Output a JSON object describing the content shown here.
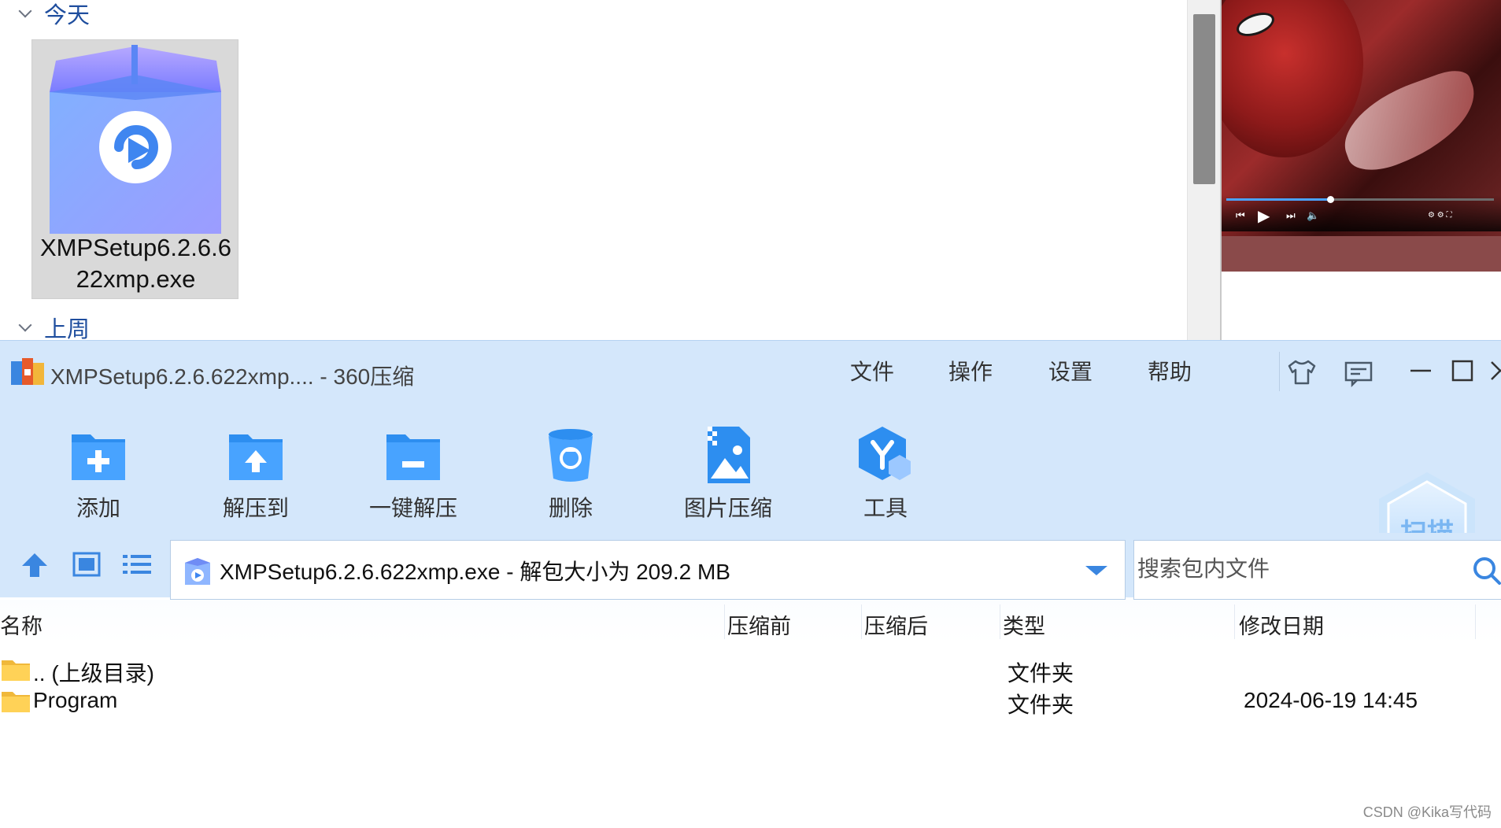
{
  "explorer": {
    "groups": [
      {
        "label": "今天"
      },
      {
        "label": "上周"
      }
    ],
    "file": {
      "name": "XMPSetup6.2.6.622xmp.exe"
    }
  },
  "app": {
    "title": "XMPSetup6.2.6.622xmp.... - 360压缩",
    "menu": [
      "文件",
      "操作",
      "设置",
      "帮助"
    ],
    "toolbar": [
      {
        "label": "添加",
        "icon": "add-folder-icon"
      },
      {
        "label": "解压到",
        "icon": "extract-to-icon"
      },
      {
        "label": "一键解压",
        "icon": "one-click-extract-icon"
      },
      {
        "label": "删除",
        "icon": "trash-icon"
      },
      {
        "label": "图片压缩",
        "icon": "image-compress-icon"
      },
      {
        "label": "工具",
        "icon": "tools-icon"
      }
    ],
    "scan_label": "扫描",
    "address": "XMPSetup6.2.6.622xmp.exe - 解包大小为 209.2 MB",
    "search_placeholder": "搜索包内文件",
    "columns": [
      "名称",
      "压缩前",
      "压缩后",
      "类型",
      "修改日期"
    ],
    "rows": [
      {
        "name": ".. (上级目录)",
        "type": "文件夹",
        "date": ""
      },
      {
        "name": "Program",
        "type": "文件夹",
        "date": "2024-06-19 14:45"
      }
    ]
  },
  "watermark": "CSDN @Kika写代码",
  "colors": {
    "accent": "#3a86e0",
    "titlebar_bg": "#d4e7fb",
    "explorer_header": "#1f4e9e"
  }
}
